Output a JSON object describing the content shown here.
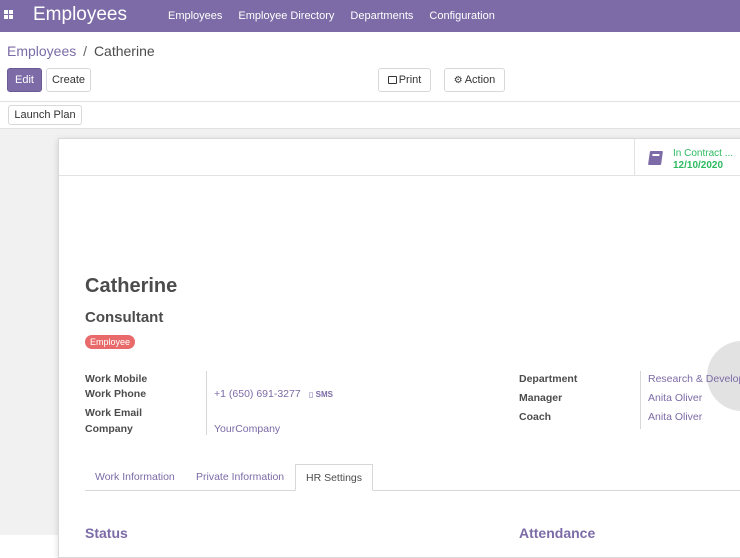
{
  "navbar": {
    "app_title": "Employees",
    "menu": [
      "Employees",
      "Employee Directory",
      "Departments",
      "Configuration"
    ]
  },
  "breadcrumb": {
    "parent": "Employees",
    "separator": "/",
    "current": "Catherine"
  },
  "toolbar": {
    "edit_label": "Edit",
    "create_label": "Create",
    "print_label": "Print",
    "action_label": "Action"
  },
  "statusbar": {
    "launch_plan_label": "Launch Plan"
  },
  "stat_button": {
    "icon": "book-icon",
    "label": "In Contract ...",
    "value": "12/10/2020"
  },
  "employee": {
    "name": "Catherine",
    "job_title": "Consultant",
    "tag": "Employee"
  },
  "fields_left": {
    "work_mobile_label": "Work Mobile",
    "work_phone_label": "Work Phone",
    "work_phone_value": "+1 (650) 691-3277",
    "sms_label": "SMS",
    "work_email_label": "Work Email",
    "company_label": "Company",
    "company_value": "YourCompany"
  },
  "fields_right": {
    "department_label": "Department",
    "department_value": "Research & Develop",
    "manager_label": "Manager",
    "manager_value": "Anita Oliver",
    "coach_label": "Coach",
    "coach_value": "Anita Oliver"
  },
  "tabs": [
    {
      "label": "Work Information",
      "active": false
    },
    {
      "label": "Private Information",
      "active": false
    },
    {
      "label": "HR Settings",
      "active": true
    }
  ],
  "sections": {
    "status_title": "Status",
    "attendance_title": "Attendance"
  },
  "colors": {
    "brand": "#7c6ba6",
    "tag": "#e86a6a",
    "contract": "#2cbb5f"
  }
}
